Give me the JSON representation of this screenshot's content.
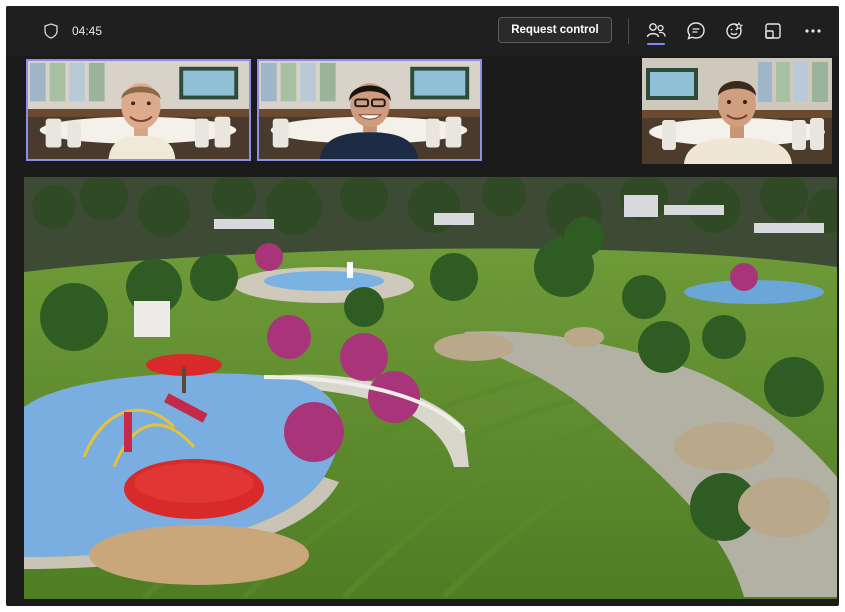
{
  "meeting": {
    "timer": "04:45",
    "request_control_label": "Request control"
  },
  "toolbar": {
    "icons": [
      "shield-icon",
      "people-icon",
      "chat-icon",
      "reactions-icon",
      "share-screen-icon",
      "more-icon"
    ],
    "active": "people-icon"
  },
  "participants": [
    {
      "position": "tile-1",
      "highlighted": true,
      "shirt": "#f1e9d8"
    },
    {
      "position": "tile-2",
      "highlighted": true,
      "shirt": "#1d2b45"
    },
    {
      "position": "tile-3",
      "highlighted": false,
      "shirt": "#efe6d3"
    }
  ],
  "shared_screen": {
    "content": "park-rendering"
  },
  "colors": {
    "accent": "#7f85f5",
    "window_bg": "#1b1b1b",
    "grass": "#5f8f2e",
    "play_area": "#7aaee0",
    "canopy": "#d82a2a"
  }
}
